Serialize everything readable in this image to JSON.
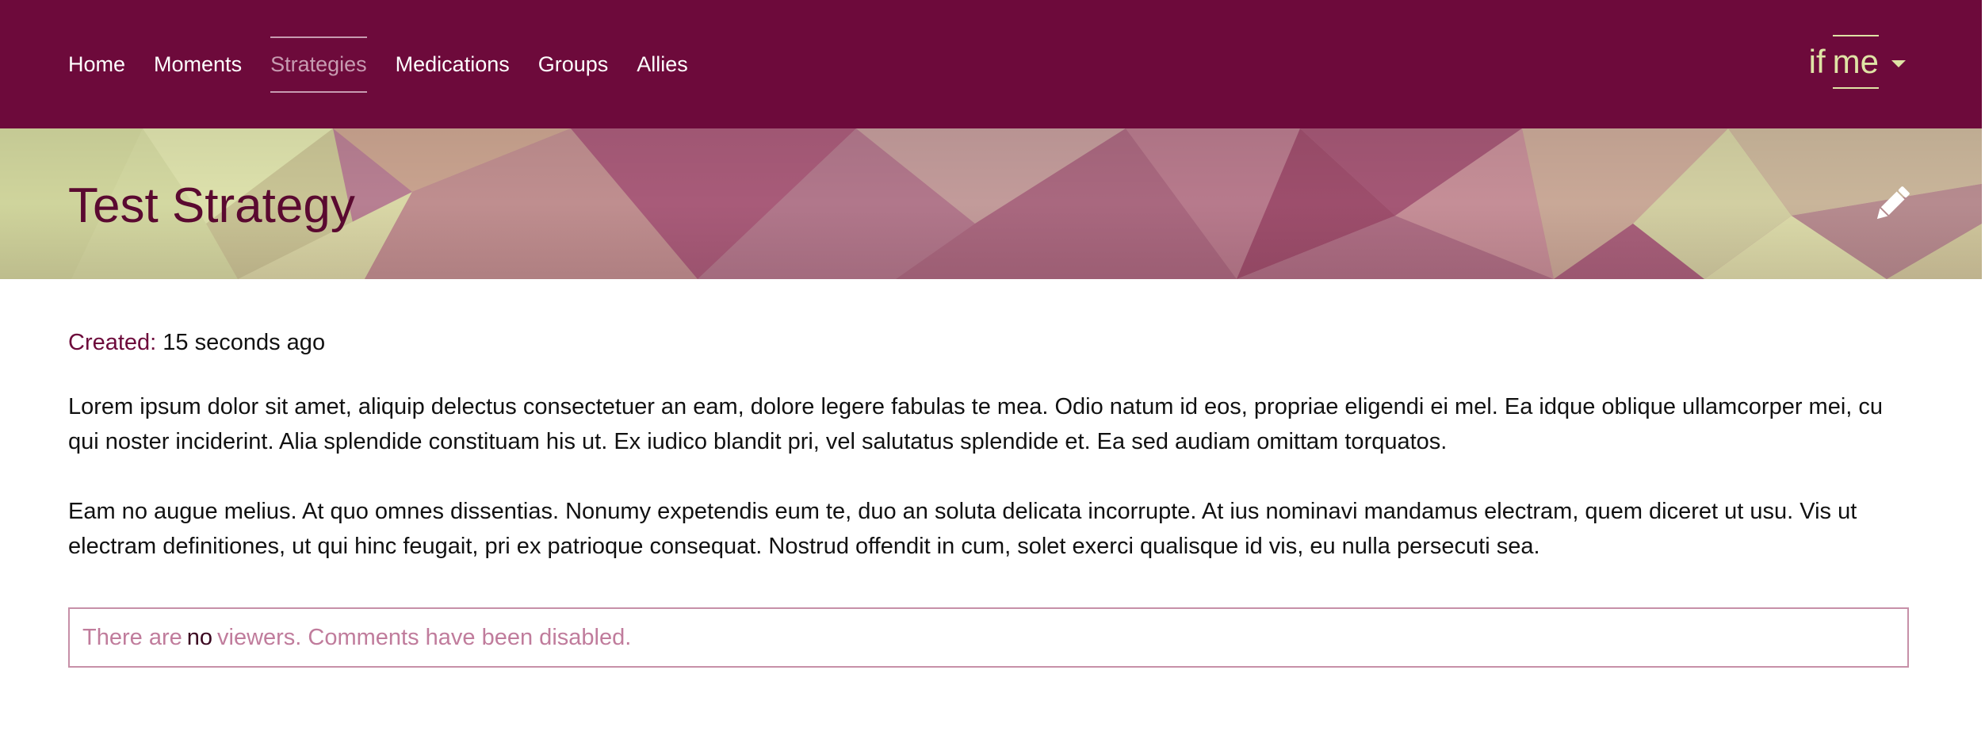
{
  "nav": {
    "items": [
      {
        "label": "Home",
        "active": false
      },
      {
        "label": "Moments",
        "active": false
      },
      {
        "label": "Strategies",
        "active": true
      },
      {
        "label": "Medications",
        "active": false
      },
      {
        "label": "Groups",
        "active": false
      },
      {
        "label": "Allies",
        "active": false
      }
    ],
    "brand": {
      "first": "if",
      "second": "me",
      "menu_icon": "caret-down-icon"
    }
  },
  "banner": {
    "title": "Test Strategy",
    "edit_icon": "pencil-icon"
  },
  "meta": {
    "created_label": "Created:",
    "created_value": "15 seconds ago"
  },
  "description": {
    "paragraphs": [
      "Lorem ipsum dolor sit amet, aliquip delectus consectetuer an eam, dolore legere fabulas te mea. Odio natum id eos, propriae eligendi ei mel. Ea idque oblique ullamcorper mei, cu qui noster inciderint. Alia splendide constituam his ut. Ex iudico blandit pri, vel salutatus splendide et. Ea sed audiam omittam torquatos.",
      "Eam no augue melius. At quo omnes dissentias. Nonumy expetendis eum te, duo an soluta delicata incorrupte. At ius nominavi mandamus electram, quem diceret ut usu. Vis ut electram definitiones, ut qui hinc feugait, pri ex patrioque consequat. Nostrud offendit in cum, solet exerci qualisque id vis, eu nulla persecuti sea."
    ]
  },
  "notice": {
    "before": "There are",
    "emphasis": "no",
    "after": "viewers. Comments have been disabled."
  },
  "colors": {
    "primary": "#6d0a3b",
    "accent": "#dfe3a5",
    "muted_link": "#c79bb1",
    "notice_text": "#c07c9c"
  }
}
